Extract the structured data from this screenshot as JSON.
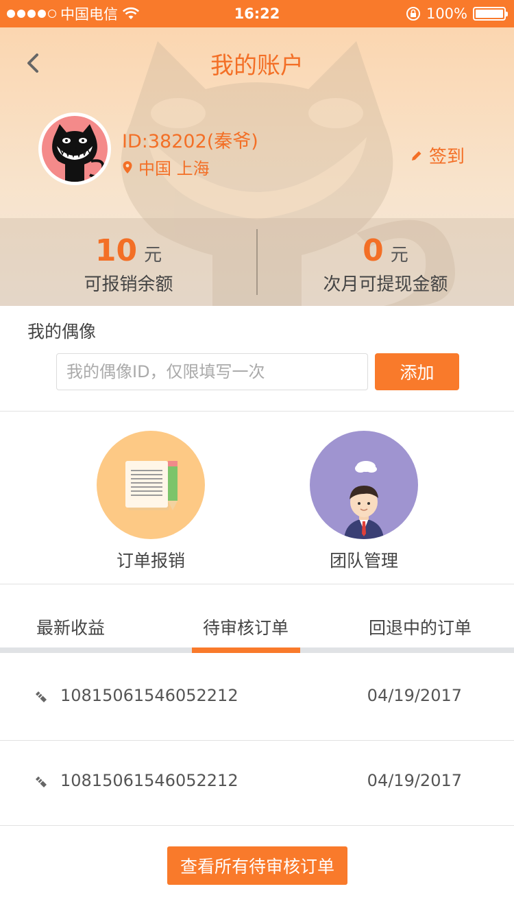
{
  "status_bar": {
    "carrier": "中国电信",
    "time": "16:22",
    "battery": "100%",
    "signal_icon": "signal-dots-icon",
    "wifi_icon": "wifi-icon",
    "lock_icon": "rotation-lock-icon",
    "battery_icon": "battery-icon"
  },
  "header": {
    "title": "我的账户",
    "back_icon": "chevron-left-icon",
    "user_id": "ID:38202(秦爷)",
    "location": "中国 上海",
    "location_icon": "map-pin-icon",
    "checkin_label": "签到",
    "checkin_icon": "pencil-icon"
  },
  "balance": {
    "reimbursable_value": "10",
    "reimbursable_unit": "元",
    "reimbursable_label": "可报销余额",
    "withdraw_value": "0",
    "withdraw_unit": "元",
    "withdraw_label": "次月可提现金额"
  },
  "idol": {
    "title": "我的偶像",
    "input_placeholder": "我的偶像ID，仅限填写一次",
    "input_value": "",
    "add_label": "添加"
  },
  "actions": {
    "order_reimburse_label": "订单报销",
    "team_manage_label": "团队管理"
  },
  "tabs": {
    "latest_earnings": "最新收益",
    "pending_orders": "待审核订单",
    "returned_orders": "回退中的订单",
    "active": "pending_orders"
  },
  "orders": [
    {
      "id": "10815061546052212",
      "date": "04/19/2017"
    },
    {
      "id": "10815061546052212",
      "date": "04/19/2017"
    }
  ],
  "view_all_label": "查看所有待审核订单",
  "colors": {
    "accent": "#f97a2b",
    "accent_text": "#f36f26",
    "avatar_bg": "#f48a8a",
    "order_icon_bg": "#fdc985",
    "team_icon_bg": "#9f94d0"
  }
}
